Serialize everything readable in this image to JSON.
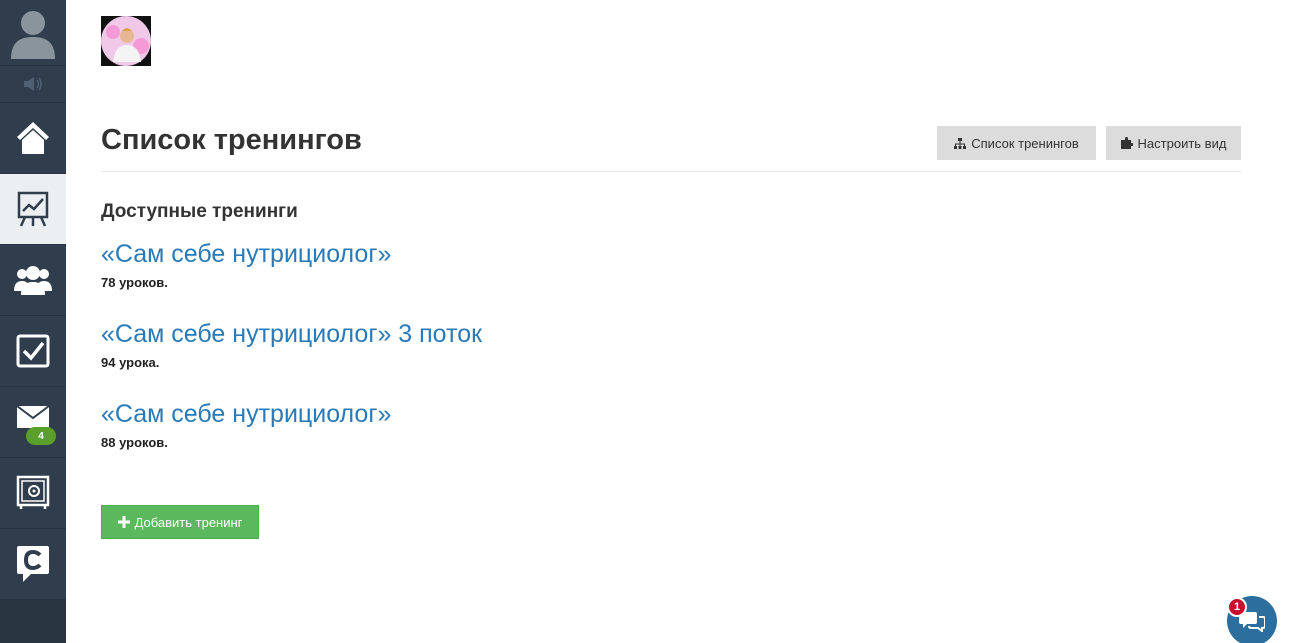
{
  "sidebar": {
    "items": [
      {
        "icon": "user-avatar-icon"
      },
      {
        "icon": "speaker-icon"
      },
      {
        "icon": "home-icon"
      },
      {
        "icon": "training-chart-icon",
        "active": true
      },
      {
        "icon": "users-icon"
      },
      {
        "icon": "tasks-checkbox-icon"
      },
      {
        "icon": "mail-icon",
        "badge": "4"
      },
      {
        "icon": "safe-icon"
      },
      {
        "icon": "chat-logo-icon"
      }
    ]
  },
  "header": {
    "title": "Список тренингов",
    "buttons": {
      "list_label": "Список тренингов",
      "view_label": "Настроить вид"
    }
  },
  "main": {
    "section_title": "Доступные тренинги",
    "trainings": [
      {
        "title": "«Сам себе нутрициолог»",
        "lessons": "78 уроков."
      },
      {
        "title": "«Сам себе нутрициолог» 3 поток",
        "lessons": "94 урока."
      },
      {
        "title": "«Сам себе нутрициолог»",
        "lessons": "88 уроков."
      }
    ],
    "add_button_label": "Добавить тренинг"
  },
  "chat_widget": {
    "badge": "1"
  },
  "colors": {
    "sidebar": "#2f3d4c",
    "link": "#2a7ab8",
    "add_button": "#5cb85c",
    "mail_badge": "#5a9f2a",
    "chat_badge": "#c8102e"
  }
}
